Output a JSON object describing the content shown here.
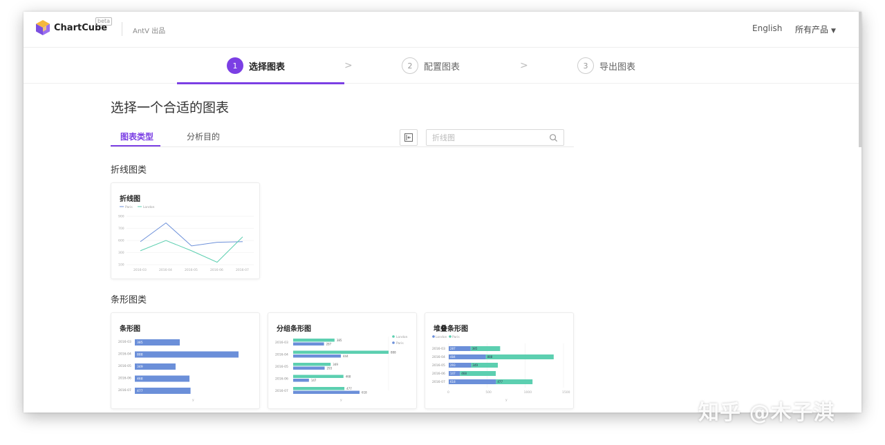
{
  "header": {
    "app_name": "ChartCube",
    "badge": "beta",
    "by": "AntV 出品",
    "lang": "English",
    "products": "所有产品",
    "caret": "▼"
  },
  "steps": [
    {
      "num": "1",
      "label": "选择图表"
    },
    {
      "num": "2",
      "label": "配置图表"
    },
    {
      "num": "3",
      "label": "导出图表"
    }
  ],
  "step_arrow": ">",
  "main": {
    "title": "选择一个合适的图表",
    "tabs": [
      "图表类型",
      "分析目的"
    ],
    "search_placeholder": "折线图"
  },
  "categories": {
    "line": "折线图类",
    "bar": "条形图类"
  },
  "cards": {
    "line": {
      "title": "折线图",
      "chart_data": {
        "type": "line",
        "legend": [
          "Paris",
          "London"
        ],
        "x": [
          "2016-03",
          "2016-04",
          "2016-05",
          "2016-06",
          "2016-07"
        ],
        "y_ticks": [
          "900",
          "700",
          "600",
          "300",
          "100"
        ],
        "series": [
          {
            "name": "Paris",
            "values": [
              480,
              790,
              410,
              470,
              480
            ]
          },
          {
            "name": "London",
            "values": [
              330,
              500,
              330,
              140,
              560
            ]
          }
        ],
        "colors": [
          "#6b8fd9",
          "#5ccfb0"
        ]
      }
    },
    "bar": {
      "title": "条形图",
      "chart_data": {
        "type": "bar",
        "categories": [
          "2016-03",
          "2016-04",
          "2016-05",
          "2016-06",
          "2016-07"
        ],
        "values": [
          385,
          888,
          349,
          468,
          477
        ],
        "labels": [
          "385",
          "888",
          "349",
          "468",
          "477"
        ],
        "xlabel": "y",
        "color": "#6b8fd9"
      }
    },
    "grouped": {
      "title": "分组条形图",
      "chart_data": {
        "type": "bar",
        "legend": [
          "London",
          "Paris"
        ],
        "categories": [
          "2016-03",
          "2016-04",
          "2016-05",
          "2016-06",
          "2016-07"
        ],
        "series": [
          {
            "name": "London",
            "values": [
              385,
              888,
              349,
              468,
              477
            ]
          },
          {
            "name": "Paris",
            "values": [
              287,
              444,
              293,
              147,
              618
            ]
          }
        ],
        "xlabel": "y",
        "colors": [
          "#5ccfb0",
          "#6b8fd9"
        ]
      }
    },
    "stacked": {
      "title": "堆叠条形图",
      "chart_data": {
        "type": "bar",
        "stacked": true,
        "legend": [
          "London",
          "Paris"
        ],
        "categories": [
          "2016-03",
          "2016-04",
          "2016-05",
          "2016-06",
          "2016-07"
        ],
        "series": [
          {
            "name": "London",
            "values": [
              287,
              484,
              293,
              147,
              618
            ]
          },
          {
            "name": "Paris",
            "values": [
              385,
              888,
              349,
              468,
              477
            ]
          }
        ],
        "x_ticks": [
          "0",
          "500",
          "1000",
          "1500"
        ],
        "xlabel": "y",
        "colors": [
          "#6b8fd9",
          "#5ccfb0"
        ]
      }
    }
  },
  "watermark": "知乎 @木子淇"
}
